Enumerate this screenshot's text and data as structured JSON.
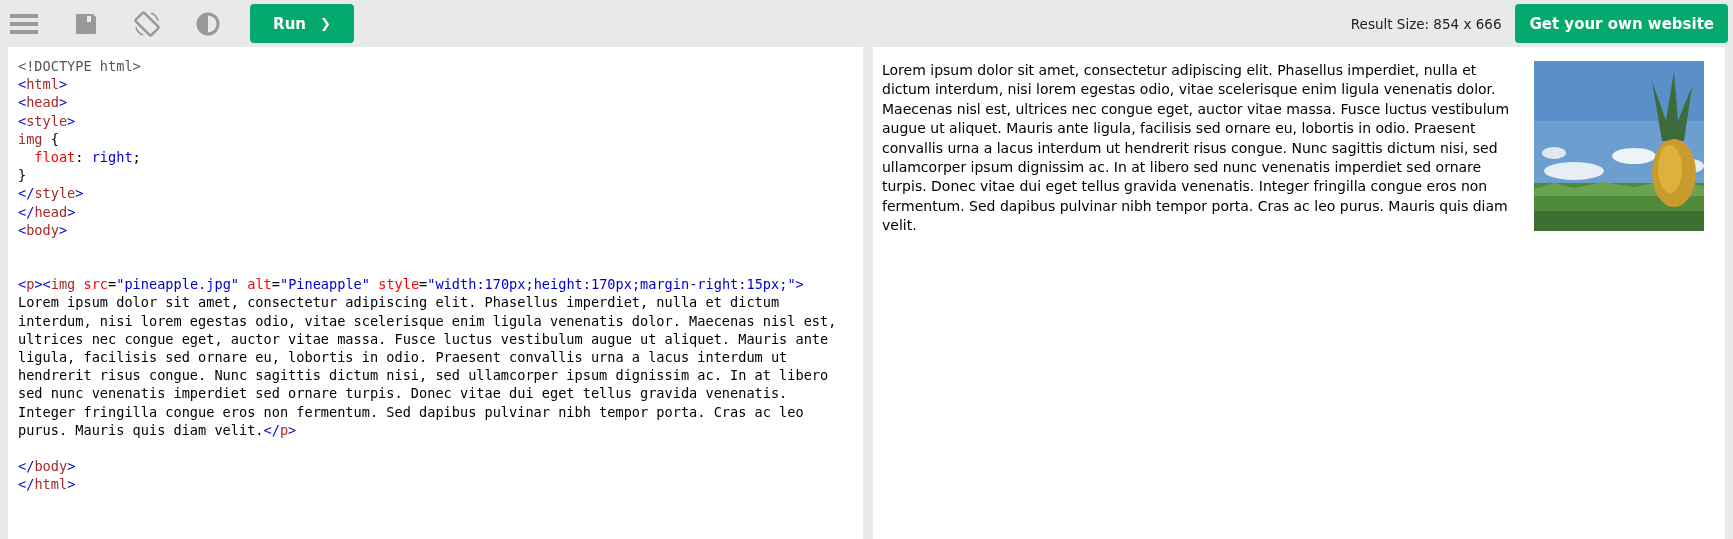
{
  "toolbar": {
    "run_button": {
      "label": "Run",
      "icon": "❯"
    },
    "result_size": "Result Size: 854 x 666",
    "own_website_button": "Get your own website"
  },
  "code_editor": {
    "lines": [
      {
        "kind": "code",
        "tokens": [
          {
            "kind": "doctype",
            "text": "<!DOCTYPE html>"
          }
        ]
      },
      {
        "kind": "code",
        "tokens": [
          {
            "kind": "bracket",
            "text": "<"
          },
          {
            "kind": "tagname",
            "text": "html"
          },
          {
            "kind": "bracket",
            "text": ">"
          }
        ]
      },
      {
        "kind": "code",
        "tokens": [
          {
            "kind": "bracket",
            "text": "<"
          },
          {
            "kind": "tagname",
            "text": "head"
          },
          {
            "kind": "bracket",
            "text": ">"
          }
        ]
      },
      {
        "kind": "code",
        "tokens": [
          {
            "kind": "bracket",
            "text": "<"
          },
          {
            "kind": "tagname",
            "text": "style"
          },
          {
            "kind": "bracket",
            "text": ">"
          }
        ]
      },
      {
        "kind": "code",
        "tokens": [
          {
            "kind": "selector",
            "text": "img"
          },
          {
            "kind": "text",
            "text": " {"
          }
        ]
      },
      {
        "kind": "code",
        "tokens": [
          {
            "kind": "property",
            "text": "  float"
          },
          {
            "kind": "text",
            "text": ": "
          },
          {
            "kind": "value",
            "text": "right"
          },
          {
            "kind": "text",
            "text": ";"
          }
        ]
      },
      {
        "kind": "code",
        "tokens": [
          {
            "kind": "text",
            "text": "}"
          }
        ]
      },
      {
        "kind": "code",
        "tokens": [
          {
            "kind": "bracket",
            "text": "</"
          },
          {
            "kind": "tagname",
            "text": "style"
          },
          {
            "kind": "bracket",
            "text": ">"
          }
        ]
      },
      {
        "kind": "code",
        "tokens": [
          {
            "kind": "bracket",
            "text": "</"
          },
          {
            "kind": "tagname",
            "text": "head"
          },
          {
            "kind": "bracket",
            "text": ">"
          }
        ]
      },
      {
        "kind": "code",
        "tokens": [
          {
            "kind": "bracket",
            "text": "<"
          },
          {
            "kind": "tagname",
            "text": "body"
          },
          {
            "kind": "bracket",
            "text": ">"
          }
        ]
      },
      {
        "kind": "blank"
      },
      {
        "kind": "blank"
      },
      {
        "kind": "code",
        "tokens": [
          {
            "kind": "bracket",
            "text": "<"
          },
          {
            "kind": "tagname",
            "text": "p"
          },
          {
            "kind": "bracket",
            "text": "><"
          },
          {
            "kind": "tagname",
            "text": "img"
          },
          {
            "kind": "attr",
            "text": " src"
          },
          {
            "kind": "text",
            "text": "="
          },
          {
            "kind": "value",
            "text": "\"pineapple.jpg\""
          },
          {
            "kind": "attr",
            "text": " alt"
          },
          {
            "kind": "text",
            "text": "="
          },
          {
            "kind": "value",
            "text": "\"Pineapple\""
          },
          {
            "kind": "attr",
            "text": " style"
          },
          {
            "kind": "text",
            "text": "="
          },
          {
            "kind": "value",
            "text": "\"width:170px;height:170px;margin-right:15px;\""
          },
          {
            "kind": "bracket",
            "text": ">"
          }
        ]
      },
      {
        "kind": "code",
        "tokens": [
          {
            "kind": "text",
            "text": "Lorem ipsum dolor sit amet, consectetur adipiscing elit. Phasellus imperdiet, nulla et dictum"
          }
        ]
      },
      {
        "kind": "code",
        "tokens": [
          {
            "kind": "text",
            "text": "interdum, nisi lorem egestas odio, vitae scelerisque enim ligula venenatis dolor. Maecenas nisl est,"
          }
        ]
      },
      {
        "kind": "code",
        "tokens": [
          {
            "kind": "text",
            "text": "ultrices nec congue eget, auctor vitae massa. Fusce luctus vestibulum augue ut aliquet. Mauris ante"
          }
        ]
      },
      {
        "kind": "code",
        "tokens": [
          {
            "kind": "text",
            "text": "ligula, facilisis sed ornare eu, lobortis in odio. Praesent convallis urna a lacus interdum ut"
          }
        ]
      },
      {
        "kind": "code",
        "tokens": [
          {
            "kind": "text",
            "text": "hendrerit risus congue. Nunc sagittis dictum nisi, sed ullamcorper ipsum dignissim ac. In at libero"
          }
        ]
      },
      {
        "kind": "code",
        "tokens": [
          {
            "kind": "text",
            "text": "sed nunc venenatis imperdiet sed ornare turpis. Donec vitae dui eget tellus gravida venenatis."
          }
        ]
      },
      {
        "kind": "code",
        "tokens": [
          {
            "kind": "text",
            "text": "Integer fringilla congue eros non fermentum. Sed dapibus pulvinar nibh tempor porta. Cras ac leo"
          }
        ]
      },
      {
        "kind": "code",
        "tokens": [
          {
            "kind": "text",
            "text": "purus. Mauris quis diam velit."
          },
          {
            "kind": "bracket",
            "text": "</"
          },
          {
            "kind": "tagname",
            "text": "p"
          },
          {
            "kind": "bracket",
            "text": ">"
          }
        ]
      },
      {
        "kind": "blank"
      },
      {
        "kind": "code",
        "tokens": [
          {
            "kind": "bracket",
            "text": "</"
          },
          {
            "kind": "tagname",
            "text": "body"
          },
          {
            "kind": "bracket",
            "text": ">"
          }
        ]
      },
      {
        "kind": "code",
        "tokens": [
          {
            "kind": "bracket",
            "text": "</"
          },
          {
            "kind": "tagname",
            "text": "html"
          },
          {
            "kind": "bracket",
            "text": ">"
          }
        ]
      }
    ]
  },
  "result": {
    "paragraph": "Lorem ipsum dolor sit amet, consectetur adipiscing elit. Phasellus imperdiet, nulla et dictum interdum, nisi lorem egestas odio, vitae scelerisque enim ligula venenatis dolor. Maecenas nisl est, ultrices nec congue eget, auctor vitae massa. Fusce luctus vestibulum augue ut aliquet. Mauris ante ligula, facilisis sed ornare eu, lobortis in odio. Praesent convallis urna a lacus interdum ut hendrerit risus congue. Nunc sagittis dictum nisi, sed ullamcorper ipsum dignissim ac. In at libero sed nunc venenatis imperdiet sed ornare turpis. Donec vitae dui eget tellus gravida venenatis. Integer fringilla congue eros non fermentum. Sed dapibus pulvinar nibh tempor porta. Cras ac leo purus. Mauris quis diam velit."
  }
}
